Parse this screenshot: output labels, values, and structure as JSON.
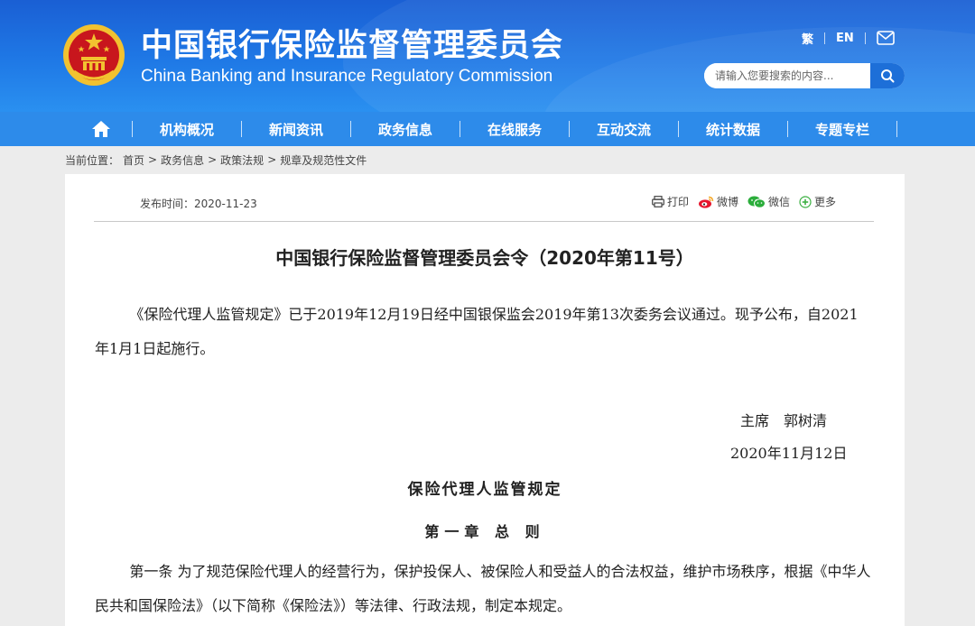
{
  "header": {
    "title_cn": "中国银行保险监督管理委员会",
    "title_en": "China Banking and Insurance Regulatory Commission",
    "lang_trad": "繁",
    "lang_en": "EN",
    "search_placeholder": "请输入您要搜索的内容..."
  },
  "nav": {
    "items": [
      "机构概况",
      "新闻资讯",
      "政务信息",
      "在线服务",
      "互动交流",
      "统计数据",
      "专题专栏"
    ]
  },
  "breadcrumb": {
    "prefix": "当前位置：",
    "items": [
      "首页",
      ">",
      "政务信息",
      ">",
      "政策法规",
      ">",
      "规章及规范性文件"
    ]
  },
  "article": {
    "publish_label": "发布时间：",
    "publish_date": "2020-11-23",
    "share": {
      "print": "打印",
      "weibo": "微博",
      "wechat": "微信",
      "more": "更多"
    },
    "title": "中国银行保险监督管理委员会令（2020年第11号）",
    "para1": "《保险代理人监管规定》已于2019年12月19日经中国银保监会2019年第13次委务会议通过。现予公布，自2021年1月1日起施行。",
    "sign_name": "主席　郭树清",
    "sign_date": "2020年11月12日",
    "reg_title": "保险代理人监管规定",
    "chapter_title": "第一章 总 则",
    "para2": "第一条 为了规范保险代理人的经营行为，保护投保人、被保险人和受益人的合法权益，维护市场秩序，根据《中华人民共和国保险法》（以下简称《保险法》）等法律、行政法规，制定本规定。"
  },
  "colors": {
    "header_blue": "#1f79e6",
    "nav_blue": "#2d8bea",
    "emblem_red": "#c8161d",
    "emblem_gold": "#f2c230"
  }
}
